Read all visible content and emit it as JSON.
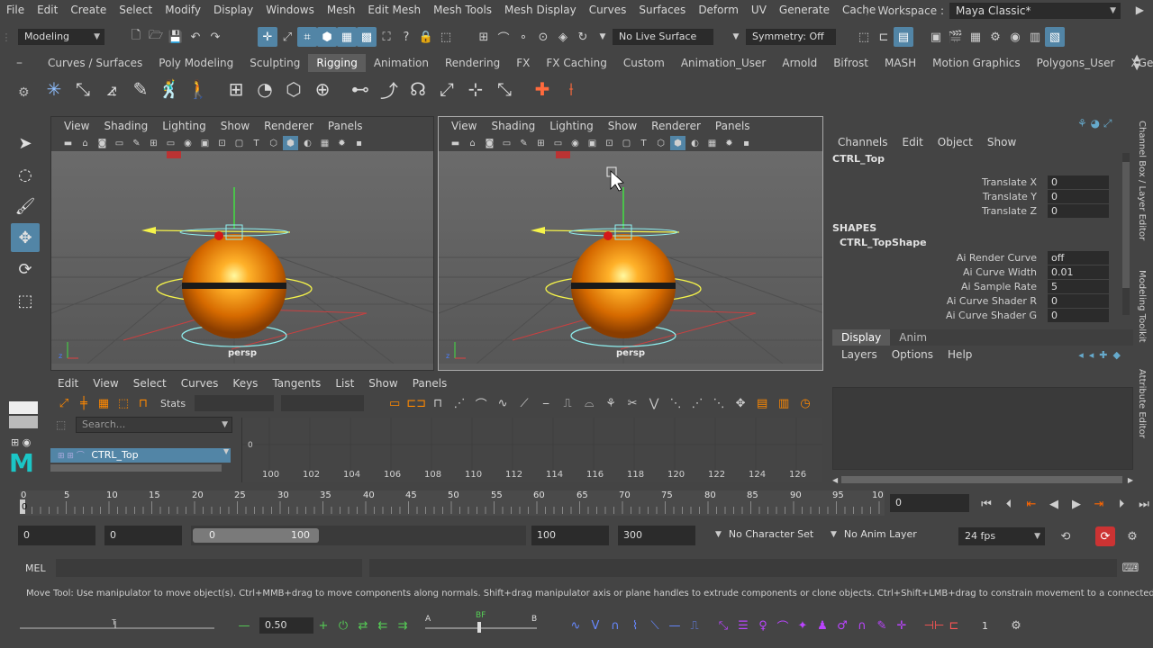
{
  "menubar": {
    "items": [
      "File",
      "Edit",
      "Create",
      "Select",
      "Modify",
      "Display",
      "Windows",
      "Mesh",
      "Edit Mesh",
      "Mesh Tools",
      "Mesh Display",
      "Curves",
      "Surfaces",
      "Deform",
      "UV",
      "Generate",
      "Cache"
    ],
    "workspace_label": "Workspace :",
    "workspace_value": "Maya Classic*"
  },
  "statusline": {
    "mode": "Modeling",
    "live_surface": "No Live Surface",
    "symmetry": "Symmetry: Off"
  },
  "shelf": {
    "tabs": [
      "Curves / Surfaces",
      "Poly Modeling",
      "Sculpting",
      "Rigging",
      "Animation",
      "Rendering",
      "FX",
      "FX Caching",
      "Custom",
      "Animation_User",
      "Arnold",
      "Bifrost",
      "MASH",
      "Motion Graphics",
      "Polygons_User",
      "XGe"
    ],
    "selected_tab": "Rigging"
  },
  "viewport_left": {
    "menu": [
      "View",
      "Shading",
      "Lighting",
      "Show",
      "Renderer",
      "Panels"
    ],
    "camera": "persp"
  },
  "viewport_right": {
    "menu": [
      "View",
      "Shading",
      "Lighting",
      "Show",
      "Renderer",
      "Panels"
    ],
    "camera": "persp"
  },
  "channel_box": {
    "menu": [
      "Channels",
      "Edit",
      "Object",
      "Show"
    ],
    "object": "CTRL_Top",
    "transform_attrs": [
      {
        "name": "Translate X",
        "value": "0"
      },
      {
        "name": "Translate Y",
        "value": "0"
      },
      {
        "name": "Translate Z",
        "value": "0"
      }
    ],
    "shapes_header": "SHAPES",
    "shape_name": "CTRL_TopShape",
    "shape_attrs": [
      {
        "name": "Ai Render Curve",
        "value": "off"
      },
      {
        "name": "Ai Curve Width",
        "value": "0.01"
      },
      {
        "name": "Ai Sample Rate",
        "value": "5"
      },
      {
        "name": "Ai Curve Shader R",
        "value": "0"
      },
      {
        "name": "Ai Curve Shader G",
        "value": "0"
      }
    ]
  },
  "side_tabs": [
    "Channel Box / Layer Editor",
    "Modeling Toolkit",
    "Attribute Editor"
  ],
  "layer_editor": {
    "tabs": [
      "Display",
      "Anim"
    ],
    "menu": [
      "Layers",
      "Options",
      "Help"
    ]
  },
  "graph_editor": {
    "menu": [
      "Edit",
      "View",
      "Select",
      "Curves",
      "Keys",
      "Tangents",
      "List",
      "Show",
      "Panels"
    ],
    "stats_label": "Stats",
    "search_placeholder": "Search...",
    "outliner_item": "CTRL_Top",
    "y_label": "0",
    "x_ticks": [
      "100",
      "102",
      "104",
      "106",
      "108",
      "110",
      "112",
      "114",
      "116",
      "118",
      "120",
      "122",
      "124",
      "126"
    ]
  },
  "timeline": {
    "ticks": [
      "0",
      "5",
      "10",
      "15",
      "20",
      "25",
      "30",
      "35",
      "40",
      "45",
      "50",
      "55",
      "60",
      "65",
      "70",
      "75",
      "80",
      "85",
      "90",
      "95",
      "10"
    ],
    "current_frame": "0"
  },
  "range": {
    "start": "0",
    "playback_start": "0",
    "slider_start": "0",
    "slider_end": "100",
    "playback_end": "100",
    "end": "300",
    "character_set": "No Character Set",
    "anim_layer": "No Anim Layer",
    "fps": "24 fps"
  },
  "cmdline": {
    "label": "MEL"
  },
  "help_text": "Move Tool: Use manipulator to move object(s). Ctrl+MMB+drag to move components along normals. Shift+drag manipulator axis or plane handles to extrude components or clone objects. Ctrl+Shift+LMB+drag to constrain movement to a connected edge. Use D or INSERT to char",
  "bottom": {
    "value": "0.50",
    "label_a": "A",
    "label_bf": "BF",
    "label_b": "B",
    "count": "1"
  }
}
